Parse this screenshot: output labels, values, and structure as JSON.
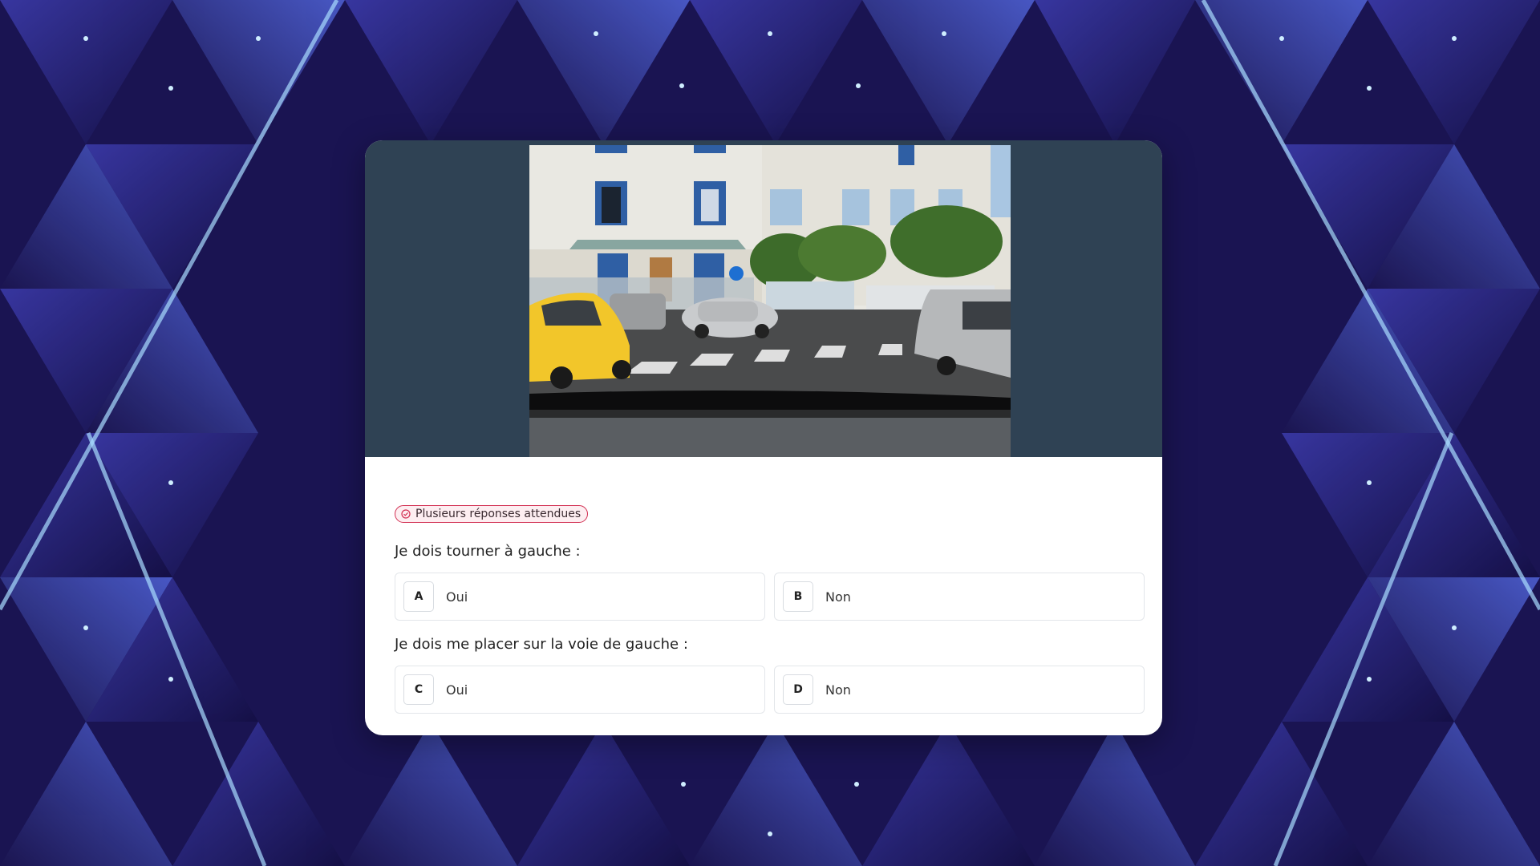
{
  "colors": {
    "card_media_bg": "#2f4254",
    "badge_border": "#d22f52",
    "badge_bg": "#fdeef1"
  },
  "badge": {
    "label": "Plusieurs réponses attendues",
    "icon": "check-circle-icon"
  },
  "questions": [
    {
      "text": "Je dois tourner à gauche :",
      "answers": [
        {
          "letter": "A",
          "label": "Oui"
        },
        {
          "letter": "B",
          "label": "Non"
        }
      ]
    },
    {
      "text": "Je dois me placer sur la voie de gauche :",
      "answers": [
        {
          "letter": "C",
          "label": "Oui"
        },
        {
          "letter": "D",
          "label": "Non"
        }
      ]
    }
  ]
}
